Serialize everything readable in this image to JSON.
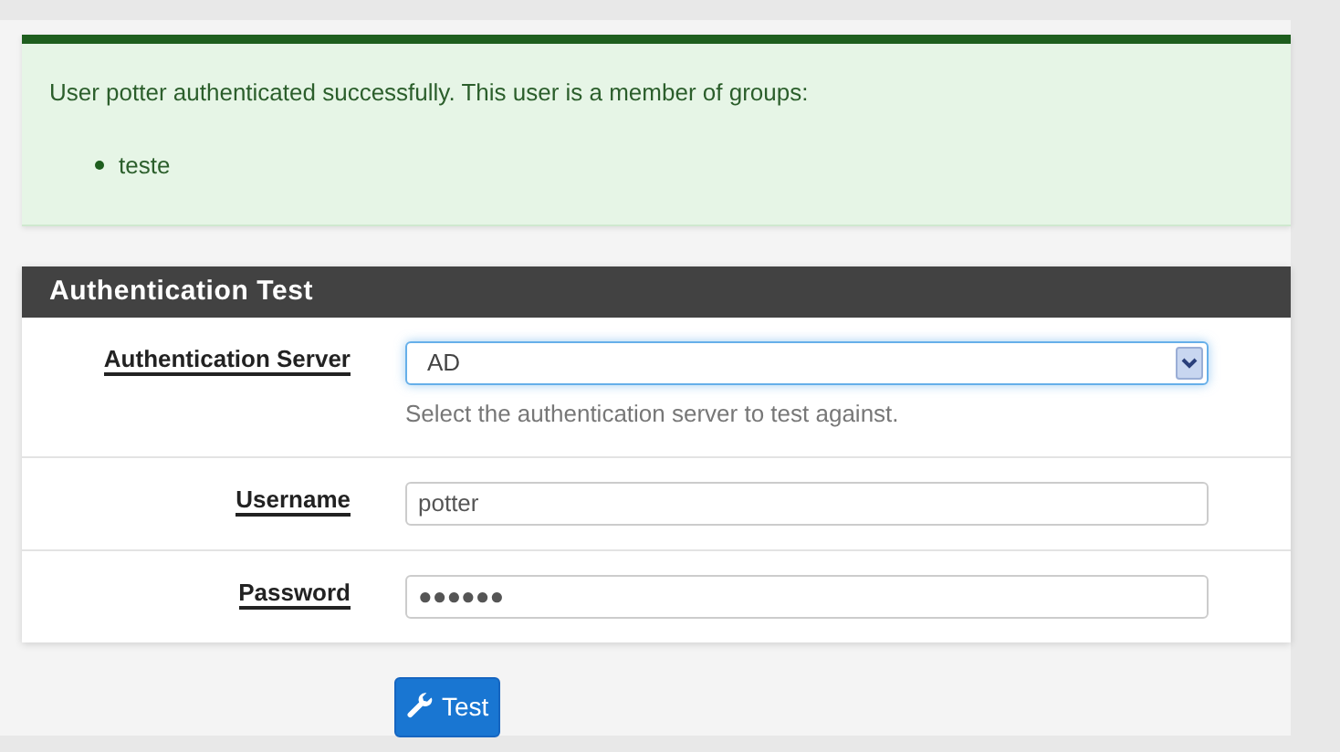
{
  "alert": {
    "message": "User potter authenticated successfully. This user is a member of groups:",
    "groups": [
      "teste"
    ]
  },
  "panel": {
    "title": "Authentication Test",
    "rows": [
      {
        "kind": "select",
        "label": "Authentication Server",
        "value": "AD",
        "help": "Select the authentication server to test against."
      },
      {
        "kind": "text",
        "label": "Username",
        "value": "potter"
      },
      {
        "kind": "text",
        "label": "Password",
        "value": "●●●●●●"
      }
    ]
  },
  "button": {
    "label": "Test"
  }
}
